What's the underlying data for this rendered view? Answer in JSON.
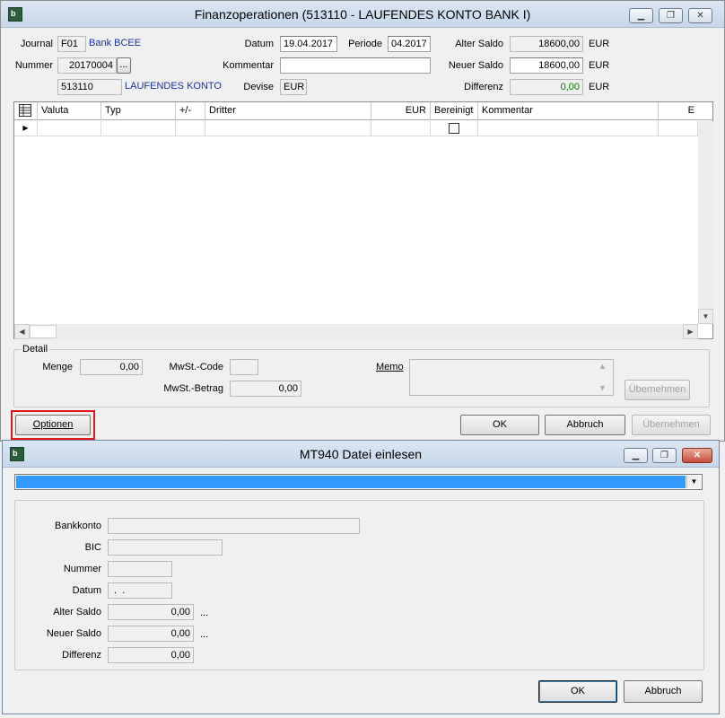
{
  "main": {
    "title": "Finanzoperationen (513110 - LAUFENDES KONTO BANK I)",
    "journal_label": "Journal",
    "journal_code": "F01",
    "journal_name": "Bank BCEE",
    "nummer_label": "Nummer",
    "nummer_value": "20170004",
    "nummer_btn": "...",
    "account_code": "513110",
    "account_name": "LAUFENDES KONTO",
    "datum_label": "Datum",
    "datum_value": "19.04.2017",
    "periode_label": "Periode",
    "periode_value": "04.2017",
    "kommentar_label": "Kommentar",
    "kommentar_value": "",
    "devise_label": "Devise",
    "devise_value": "EUR",
    "alter_saldo_label": "Alter Saldo",
    "alter_saldo_value": "18600,00",
    "neuer_saldo_label": "Neuer Saldo",
    "neuer_saldo_value": "18600,00",
    "differenz_label": "Differenz",
    "differenz_value": "0,00",
    "currency": "EUR",
    "grid": {
      "columns": [
        "Valuta",
        "Typ",
        "+/-",
        "Dritter",
        "EUR",
        "Bereinigt",
        "Kommentar",
        "E"
      ]
    },
    "detail": {
      "group_label": "Detail",
      "menge_label": "Menge",
      "menge_value": "0,00",
      "mwst_code_label": "MwSt.-Code",
      "mwst_code_value": "",
      "mwst_betrag_label": "MwSt.-Betrag",
      "mwst_betrag_value": "0,00",
      "memo_label": "Memo",
      "memo_value": "",
      "uebernehmen_btn": "Übernehmen"
    },
    "buttons": {
      "optionen": "Optionen",
      "ok": "OK",
      "abbruch": "Abbruch",
      "uebernehmen": "Übernehmen"
    },
    "highlight_color": "#e0191e"
  },
  "dialog": {
    "title": "MT940 Datei einlesen",
    "dropdown_value": "",
    "dropdown_color": "#3399ff",
    "bankkonto_label": "Bankkonto",
    "bankkonto_value": "",
    "bic_label": "BIC",
    "bic_value": "",
    "nummer_label": "Nummer",
    "nummer_value": "",
    "datum_label": "Datum",
    "datum_value": " .  .",
    "alter_saldo_label": "Alter Saldo",
    "alter_saldo_value": "0,00",
    "alter_saldo_more": "...",
    "neuer_saldo_label": "Neuer Saldo",
    "neuer_saldo_value": "0,00",
    "neuer_saldo_more": "...",
    "differenz_label": "Differenz",
    "differenz_value": "0,00",
    "buttons": {
      "ok": "OK",
      "abbruch": "Abbruch"
    }
  }
}
